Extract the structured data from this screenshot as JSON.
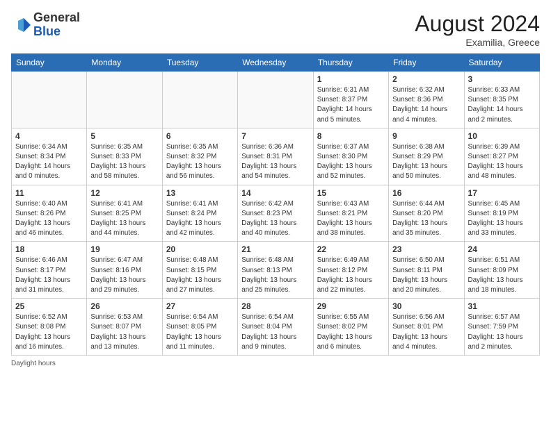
{
  "header": {
    "logo_general": "General",
    "logo_blue": "Blue",
    "month_year": "August 2024",
    "location": "Examilia, Greece"
  },
  "calendar": {
    "days_of_week": [
      "Sunday",
      "Monday",
      "Tuesday",
      "Wednesday",
      "Thursday",
      "Friday",
      "Saturday"
    ],
    "weeks": [
      [
        {
          "day": "",
          "info": ""
        },
        {
          "day": "",
          "info": ""
        },
        {
          "day": "",
          "info": ""
        },
        {
          "day": "",
          "info": ""
        },
        {
          "day": "1",
          "info": "Sunrise: 6:31 AM\nSunset: 8:37 PM\nDaylight: 14 hours\nand 5 minutes."
        },
        {
          "day": "2",
          "info": "Sunrise: 6:32 AM\nSunset: 8:36 PM\nDaylight: 14 hours\nand 4 minutes."
        },
        {
          "day": "3",
          "info": "Sunrise: 6:33 AM\nSunset: 8:35 PM\nDaylight: 14 hours\nand 2 minutes."
        }
      ],
      [
        {
          "day": "4",
          "info": "Sunrise: 6:34 AM\nSunset: 8:34 PM\nDaylight: 14 hours\nand 0 minutes."
        },
        {
          "day": "5",
          "info": "Sunrise: 6:35 AM\nSunset: 8:33 PM\nDaylight: 13 hours\nand 58 minutes."
        },
        {
          "day": "6",
          "info": "Sunrise: 6:35 AM\nSunset: 8:32 PM\nDaylight: 13 hours\nand 56 minutes."
        },
        {
          "day": "7",
          "info": "Sunrise: 6:36 AM\nSunset: 8:31 PM\nDaylight: 13 hours\nand 54 minutes."
        },
        {
          "day": "8",
          "info": "Sunrise: 6:37 AM\nSunset: 8:30 PM\nDaylight: 13 hours\nand 52 minutes."
        },
        {
          "day": "9",
          "info": "Sunrise: 6:38 AM\nSunset: 8:29 PM\nDaylight: 13 hours\nand 50 minutes."
        },
        {
          "day": "10",
          "info": "Sunrise: 6:39 AM\nSunset: 8:27 PM\nDaylight: 13 hours\nand 48 minutes."
        }
      ],
      [
        {
          "day": "11",
          "info": "Sunrise: 6:40 AM\nSunset: 8:26 PM\nDaylight: 13 hours\nand 46 minutes."
        },
        {
          "day": "12",
          "info": "Sunrise: 6:41 AM\nSunset: 8:25 PM\nDaylight: 13 hours\nand 44 minutes."
        },
        {
          "day": "13",
          "info": "Sunrise: 6:41 AM\nSunset: 8:24 PM\nDaylight: 13 hours\nand 42 minutes."
        },
        {
          "day": "14",
          "info": "Sunrise: 6:42 AM\nSunset: 8:23 PM\nDaylight: 13 hours\nand 40 minutes."
        },
        {
          "day": "15",
          "info": "Sunrise: 6:43 AM\nSunset: 8:21 PM\nDaylight: 13 hours\nand 38 minutes."
        },
        {
          "day": "16",
          "info": "Sunrise: 6:44 AM\nSunset: 8:20 PM\nDaylight: 13 hours\nand 35 minutes."
        },
        {
          "day": "17",
          "info": "Sunrise: 6:45 AM\nSunset: 8:19 PM\nDaylight: 13 hours\nand 33 minutes."
        }
      ],
      [
        {
          "day": "18",
          "info": "Sunrise: 6:46 AM\nSunset: 8:17 PM\nDaylight: 13 hours\nand 31 minutes."
        },
        {
          "day": "19",
          "info": "Sunrise: 6:47 AM\nSunset: 8:16 PM\nDaylight: 13 hours\nand 29 minutes."
        },
        {
          "day": "20",
          "info": "Sunrise: 6:48 AM\nSunset: 8:15 PM\nDaylight: 13 hours\nand 27 minutes."
        },
        {
          "day": "21",
          "info": "Sunrise: 6:48 AM\nSunset: 8:13 PM\nDaylight: 13 hours\nand 25 minutes."
        },
        {
          "day": "22",
          "info": "Sunrise: 6:49 AM\nSunset: 8:12 PM\nDaylight: 13 hours\nand 22 minutes."
        },
        {
          "day": "23",
          "info": "Sunrise: 6:50 AM\nSunset: 8:11 PM\nDaylight: 13 hours\nand 20 minutes."
        },
        {
          "day": "24",
          "info": "Sunrise: 6:51 AM\nSunset: 8:09 PM\nDaylight: 13 hours\nand 18 minutes."
        }
      ],
      [
        {
          "day": "25",
          "info": "Sunrise: 6:52 AM\nSunset: 8:08 PM\nDaylight: 13 hours\nand 16 minutes."
        },
        {
          "day": "26",
          "info": "Sunrise: 6:53 AM\nSunset: 8:07 PM\nDaylight: 13 hours\nand 13 minutes."
        },
        {
          "day": "27",
          "info": "Sunrise: 6:54 AM\nSunset: 8:05 PM\nDaylight: 13 hours\nand 11 minutes."
        },
        {
          "day": "28",
          "info": "Sunrise: 6:54 AM\nSunset: 8:04 PM\nDaylight: 13 hours\nand 9 minutes."
        },
        {
          "day": "29",
          "info": "Sunrise: 6:55 AM\nSunset: 8:02 PM\nDaylight: 13 hours\nand 6 minutes."
        },
        {
          "day": "30",
          "info": "Sunrise: 6:56 AM\nSunset: 8:01 PM\nDaylight: 13 hours\nand 4 minutes."
        },
        {
          "day": "31",
          "info": "Sunrise: 6:57 AM\nSunset: 7:59 PM\nDaylight: 13 hours\nand 2 minutes."
        }
      ]
    ]
  },
  "footer": {
    "daylight_label": "Daylight hours"
  }
}
